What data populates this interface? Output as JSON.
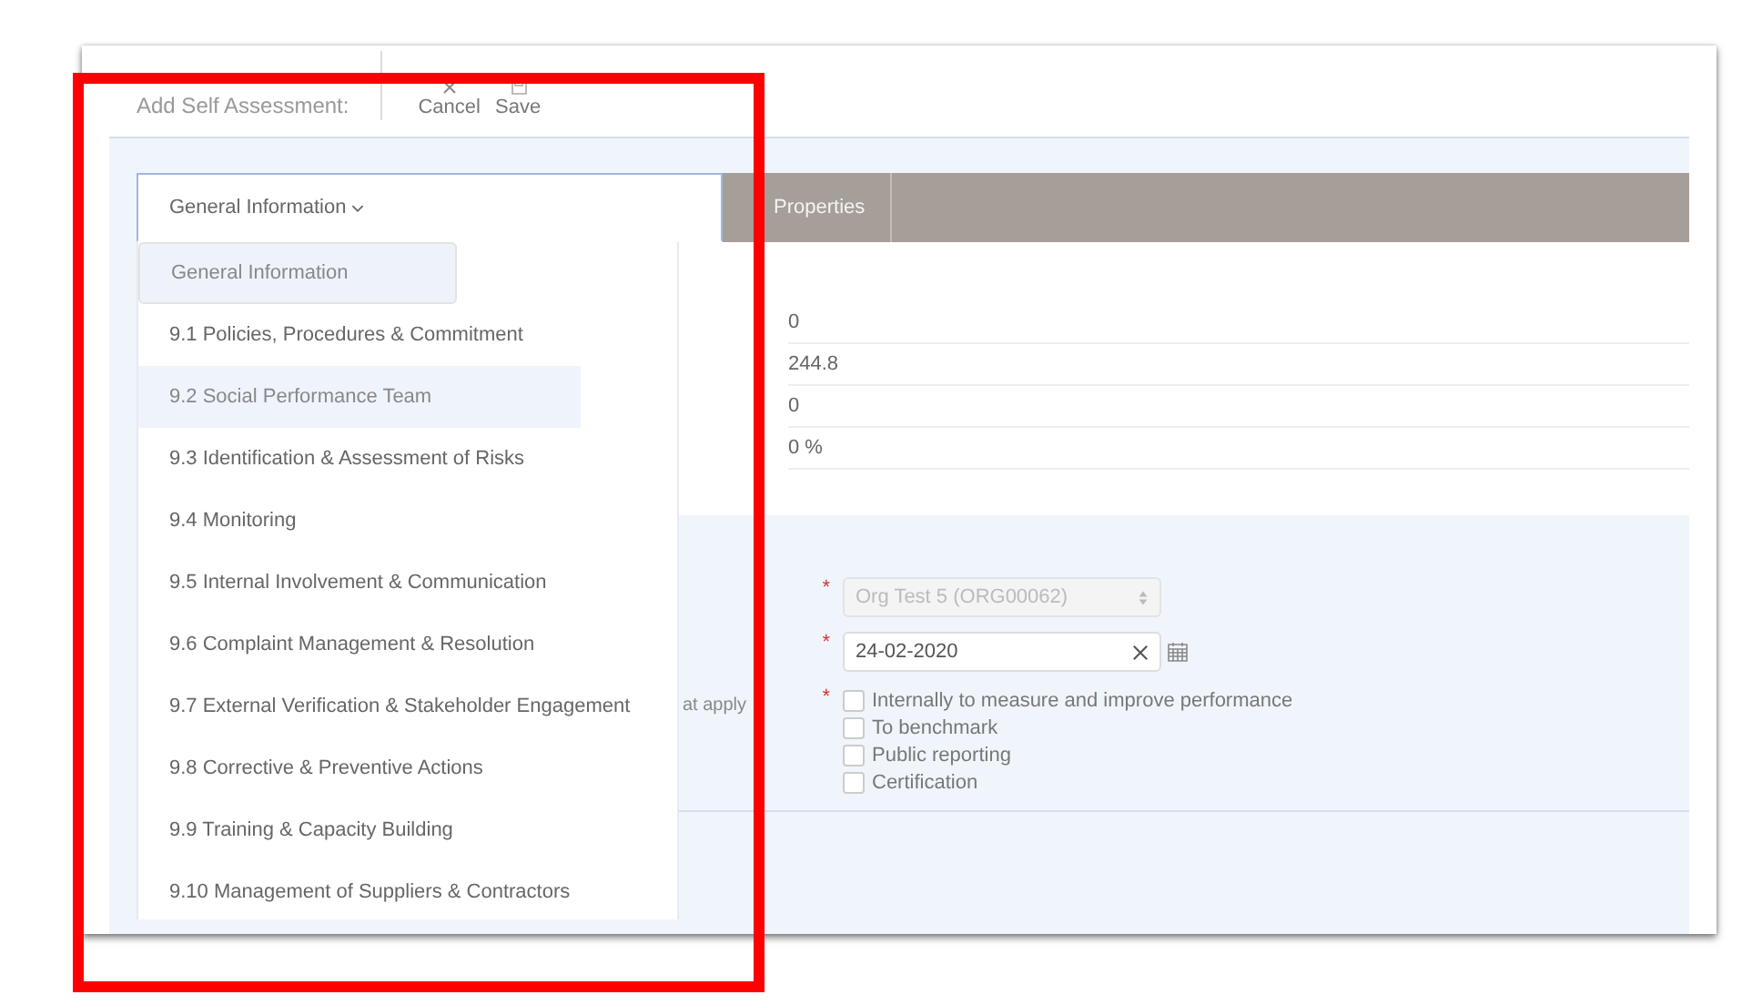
{
  "header": {
    "title": "Add Self Assessment:",
    "actions": [
      {
        "kind": "cancel",
        "label": "Cancel"
      },
      {
        "kind": "save",
        "label": "Save"
      }
    ]
  },
  "tabs": [
    {
      "label": "General Information",
      "kind": "dropdown",
      "selected": true
    },
    {
      "label": "Properties",
      "kind": "tab",
      "selected": false
    }
  ],
  "dropdown_items": [
    {
      "label": "General Information",
      "selected": true,
      "hovered": false
    },
    {
      "label": "9.1 Policies, Procedures & Commitment",
      "selected": false,
      "hovered": false
    },
    {
      "label": "9.2 Social Performance Team",
      "selected": false,
      "hovered": true
    },
    {
      "label": "9.3 Identification & Assessment of Risks",
      "selected": false,
      "hovered": false
    },
    {
      "label": "9.4 Monitoring",
      "selected": false,
      "hovered": false
    },
    {
      "label": "9.5 Internal Involvement & Communication",
      "selected": false,
      "hovered": false
    },
    {
      "label": "9.6 Complaint Management & Resolution",
      "selected": false,
      "hovered": false
    },
    {
      "label": "9.7 External Verification & Stakeholder Engagement",
      "selected": false,
      "hovered": false
    },
    {
      "label": "9.8 Corrective & Preventive Actions",
      "selected": false,
      "hovered": false
    },
    {
      "label": "9.9 Training & Capacity Building",
      "selected": false,
      "hovered": false
    },
    {
      "label": "9.10 Management of Suppliers & Contractors",
      "selected": false,
      "hovered": false
    }
  ],
  "values": [
    "0",
    "244.8",
    "0",
    "0 %"
  ],
  "form": [
    {
      "kind": "select",
      "required_mark": "*",
      "value": "Org Test 5 (ORG00062)",
      "disabled": true
    },
    {
      "kind": "date",
      "required_mark": "*",
      "value": "24-02-2020"
    },
    {
      "kind": "checkboxes",
      "required_mark": "*",
      "label": "at apply",
      "options": [
        {
          "label": "Internally to measure and improve performance",
          "checked": false
        },
        {
          "label": "To benchmark",
          "checked": false
        },
        {
          "label": "Public reporting",
          "checked": false
        },
        {
          "label": "Certification",
          "checked": false
        }
      ]
    }
  ],
  "highlight_frame": true
}
